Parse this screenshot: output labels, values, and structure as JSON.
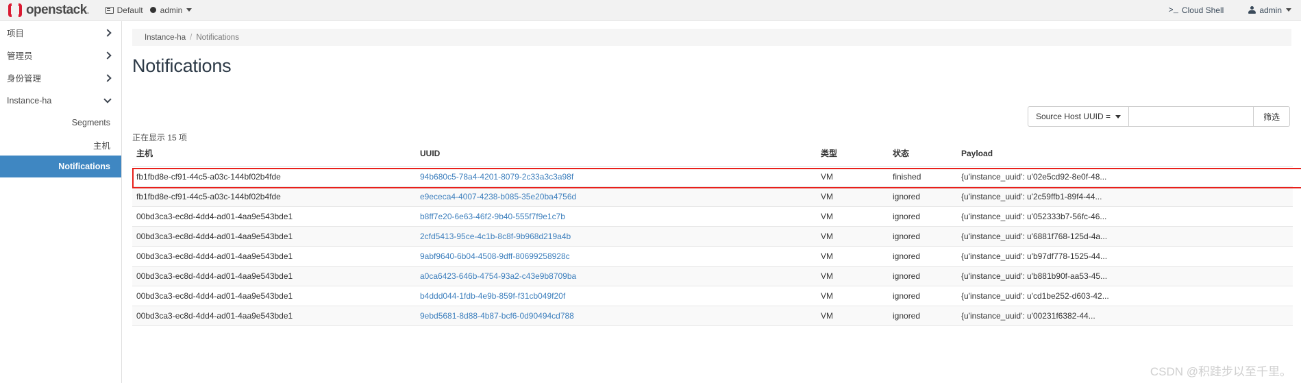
{
  "topbar": {
    "brand": "openstack",
    "brand_dot": ".",
    "domain_label": "Default",
    "user_label": "admin",
    "cloud_shell_prompt": ">_",
    "cloud_shell_label": "Cloud Shell",
    "account_label": "admin",
    "accent_red": "#da1a32",
    "background": "#f2f2f2"
  },
  "sidebar": {
    "active_color": "#3f87c2",
    "groups": [
      {
        "label": "项目",
        "state": "collapsed"
      },
      {
        "label": "管理员",
        "state": "collapsed"
      },
      {
        "label": "身份管理",
        "state": "collapsed"
      },
      {
        "label": "Instance-ha",
        "state": "expanded"
      }
    ],
    "sub_items": [
      {
        "label": "Segments",
        "active": false
      },
      {
        "label": "主机",
        "active": false
      },
      {
        "label": "Notifications",
        "active": true
      }
    ]
  },
  "breadcrumb": {
    "parent": "Instance-ha",
    "separator": "/",
    "current": "Notifications"
  },
  "page": {
    "title": "Notifications",
    "count_text": "正在显示 15 项"
  },
  "filter": {
    "selected_field": "Source Host UUID =",
    "input_value": "",
    "input_placeholder": "",
    "button_label": "筛选"
  },
  "table": {
    "headers": [
      "主机",
      "UUID",
      "类型",
      "状态",
      "Payload"
    ],
    "rows": [
      {
        "host": "fb1fbd8e-cf91-44c5-a03c-144bf02b4fde",
        "uuid": "94b680c5-78a4-4201-8079-2c33a3c3a98f",
        "type": "VM",
        "status": "finished",
        "payload": "{u'instance_uuid': u'02e5cd92-8e0f-48..."
      },
      {
        "host": "fb1fbd8e-cf91-44c5-a03c-144bf02b4fde",
        "uuid": "e9ececa4-4007-4238-b085-35e20ba4756d",
        "type": "VM",
        "status": "ignored",
        "payload": "{u'instance_uuid': u'2c59ffb1-89f4-44..."
      },
      {
        "host": "00bd3ca3-ec8d-4dd4-ad01-4aa9e543bde1",
        "uuid": "b8ff7e20-6e63-46f2-9b40-555f7f9e1c7b",
        "type": "VM",
        "status": "ignored",
        "payload": "{u'instance_uuid': u'052333b7-56fc-46..."
      },
      {
        "host": "00bd3ca3-ec8d-4dd4-ad01-4aa9e543bde1",
        "uuid": "2cfd5413-95ce-4c1b-8c8f-9b968d219a4b",
        "type": "VM",
        "status": "ignored",
        "payload": "{u'instance_uuid': u'6881f768-125d-4a..."
      },
      {
        "host": "00bd3ca3-ec8d-4dd4-ad01-4aa9e543bde1",
        "uuid": "9abf9640-6b04-4508-9dff-80699258928c",
        "type": "VM",
        "status": "ignored",
        "payload": "{u'instance_uuid': u'b97df778-1525-44..."
      },
      {
        "host": "00bd3ca3-ec8d-4dd4-ad01-4aa9e543bde1",
        "uuid": "a0ca6423-646b-4754-93a2-c43e9b8709ba",
        "type": "VM",
        "status": "ignored",
        "payload": "{u'instance_uuid': u'b881b90f-aa53-45..."
      },
      {
        "host": "00bd3ca3-ec8d-4dd4-ad01-4aa9e543bde1",
        "uuid": "b4ddd044-1fdb-4e9b-859f-f31cb049f20f",
        "type": "VM",
        "status": "ignored",
        "payload": "{u'instance_uuid': u'cd1be252-d603-42..."
      },
      {
        "host": "00bd3ca3-ec8d-4dd4-ad01-4aa9e543bde1",
        "uuid": "9ebd5681-8d88-4b87-bcf6-0d90494cd788",
        "type": "VM",
        "status": "ignored",
        "payload": "{u'instance_uuid': u'00231f6382-44..."
      }
    ],
    "highlight_row_index": 0,
    "highlight_color": "#e8201b"
  },
  "watermark": {
    "text": "CSDN @积跬步以至千里。"
  }
}
